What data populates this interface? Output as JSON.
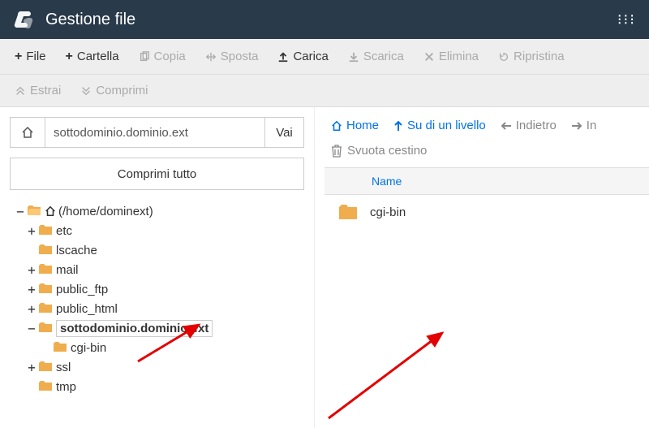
{
  "header": {
    "title": "Gestione file"
  },
  "toolbar": {
    "file": "File",
    "folder": "Cartella",
    "copy": "Copia",
    "move": "Sposta",
    "upload": "Carica",
    "download": "Scarica",
    "delete": "Elimina",
    "restore": "Ripristina",
    "extract": "Estrai",
    "compress": "Comprimi"
  },
  "sidebar": {
    "path_value": "sottodominio.dominio.ext",
    "go": "Vai",
    "compress_all": "Comprimi tutto",
    "root_label": "(/home/dominext)",
    "tree": [
      {
        "label": "etc",
        "expandable": true
      },
      {
        "label": "lscache",
        "expandable": false
      },
      {
        "label": "mail",
        "expandable": true
      },
      {
        "label": "public_ftp",
        "expandable": true
      },
      {
        "label": "public_html",
        "expandable": true
      },
      {
        "label": "sottodominio.dominio.ext",
        "expandable": true,
        "selected": true,
        "children": [
          {
            "label": "cgi-bin",
            "expandable": false
          }
        ]
      },
      {
        "label": "ssl",
        "expandable": true
      },
      {
        "label": "tmp",
        "expandable": false
      }
    ]
  },
  "main": {
    "nav": {
      "home": "Home",
      "up": "Su di un livello",
      "back": "Indietro",
      "forward": "In"
    },
    "empty_trash": "Svuota cestino",
    "col_name": "Name",
    "rows": [
      {
        "name": "cgi-bin"
      }
    ]
  }
}
